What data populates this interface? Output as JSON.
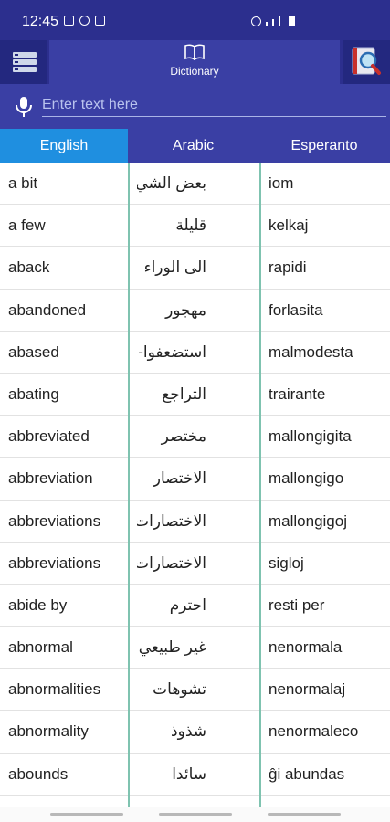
{
  "status": {
    "time": "12:45"
  },
  "header": {
    "title": "Dictionary"
  },
  "input": {
    "placeholder": "Enter text here"
  },
  "tabs": [
    {
      "label": "English",
      "active": true
    },
    {
      "label": "Arabic",
      "active": false
    },
    {
      "label": "Esperanto",
      "active": false
    }
  ],
  "rows": [
    {
      "english": "a bit",
      "arabic": "بعض الشيء",
      "esperanto": "iom"
    },
    {
      "english": "a few",
      "arabic": "قليلة",
      "esperanto": "kelkaj"
    },
    {
      "english": "aback",
      "arabic": "الى الوراء",
      "esperanto": "rapidi"
    },
    {
      "english": "abandoned",
      "arabic": "مهجور",
      "esperanto": "forlasita"
    },
    {
      "english": "abased",
      "arabic": "استضعفوا-",
      "esperanto": "malmodesta"
    },
    {
      "english": "abating",
      "arabic": "التراجع",
      "esperanto": "trairante"
    },
    {
      "english": "abbreviated",
      "arabic": "مختصر",
      "esperanto": "mallongigita"
    },
    {
      "english": "abbreviation",
      "arabic": "الاختصار",
      "esperanto": "mallongigo"
    },
    {
      "english": "abbreviations",
      "arabic": "الاختصارات",
      "esperanto": "mallongigoj"
    },
    {
      "english": "abbreviations",
      "arabic": "الاختصارات",
      "esperanto": "sigloj"
    },
    {
      "english": "abide by",
      "arabic": "احترم",
      "esperanto": "resti per"
    },
    {
      "english": "abnormal",
      "arabic": "غير طبيعي",
      "esperanto": "nenormala"
    },
    {
      "english": "abnormalities",
      "arabic": "تشوهات",
      "esperanto": "nenormalaj"
    },
    {
      "english": "abnormality",
      "arabic": "شذوذ",
      "esperanto": "nenormaleco"
    },
    {
      "english": "abounds",
      "arabic": "سائدا",
      "esperanto": "ĝi abundas"
    }
  ],
  "colors": {
    "bar": "#2c2f8e",
    "accent_tab": "#1f8fe0",
    "divider": "#7fc3b0"
  },
  "icons": [
    "menu-icon",
    "book-icon",
    "search-book-icon",
    "mic-icon"
  ]
}
